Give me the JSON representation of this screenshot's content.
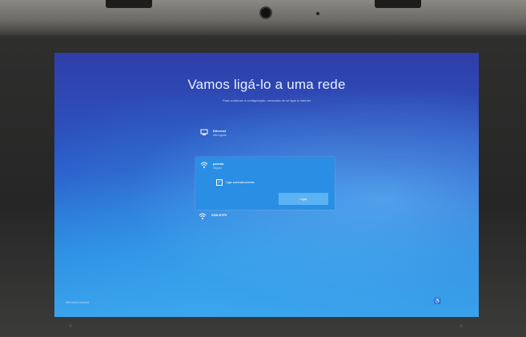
{
  "setup": {
    "title": "Vamos ligá-lo a uma rede",
    "subtitle": "Para continuar a configuração, necessita de se ligar à Internet"
  },
  "networks": {
    "ethernet": {
      "name": "Ethernet",
      "status": "Não ligado",
      "icon": "ethernet-icon"
    },
    "selected": {
      "name": "pereira",
      "status": "Seguro",
      "icon": "wifi-secure-icon",
      "auto_connect_label": "Ligar automaticamente",
      "auto_connect_checked": true,
      "connect_label": "Ligar"
    },
    "other": {
      "name": "ZON-E7F0",
      "icon": "wifi-icon"
    }
  },
  "footer": {
    "left_link": "Não tenho Internet",
    "accessibility_icon": "accessibility-icon"
  },
  "colors": {
    "screen_top": "#2f3ea8",
    "screen_bottom": "#3aa2ec",
    "selected_card": "#2a8fe4",
    "button": "#5cb3f3"
  }
}
